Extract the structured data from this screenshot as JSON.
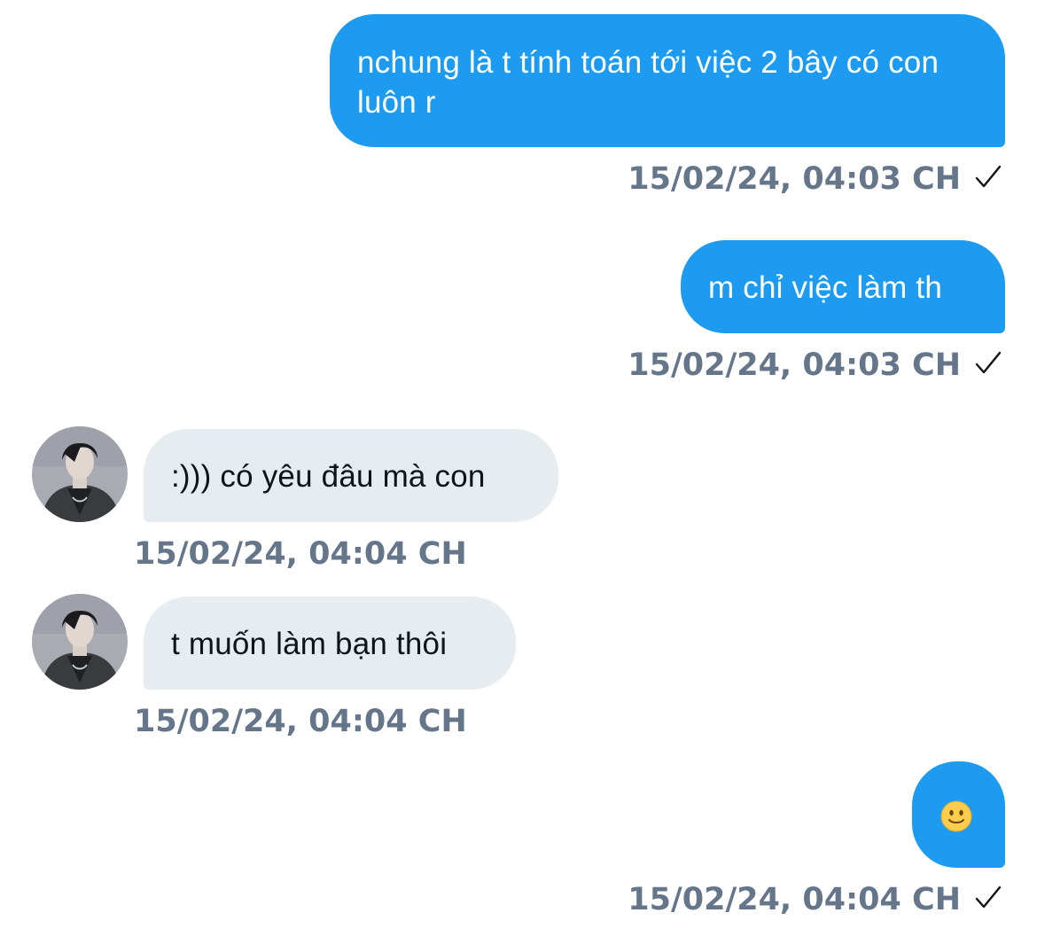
{
  "messages": [
    {
      "direction": "outgoing",
      "text": "nchung là t tính toán tới việc 2 bây có con luôn r",
      "timestamp": "15/02/24, 04:03 CH",
      "status": "sent-check-icon"
    },
    {
      "direction": "outgoing",
      "text": "m chỉ việc làm th",
      "timestamp": "15/02/24, 04:03 CH",
      "status": "sent-check-icon"
    },
    {
      "direction": "incoming",
      "text": ":))) có yêu đâu mà con",
      "timestamp": "15/02/24, 04:04 CH",
      "avatar": "contact-avatar"
    },
    {
      "direction": "incoming",
      "text": "t muốn làm bạn thôi",
      "timestamp": "15/02/24, 04:04 CH",
      "avatar": "contact-avatar"
    },
    {
      "direction": "outgoing",
      "text": "",
      "emoji": "slightly-smiling-face-icon",
      "timestamp": "15/02/24, 04:04 CH",
      "status": "sent-check-icon"
    }
  ],
  "colors": {
    "outgoing_bubble": "#1d9bf0",
    "incoming_bubble": "#e7ecf0",
    "timestamp_text": "#66768a",
    "incoming_text": "#0f1419"
  }
}
